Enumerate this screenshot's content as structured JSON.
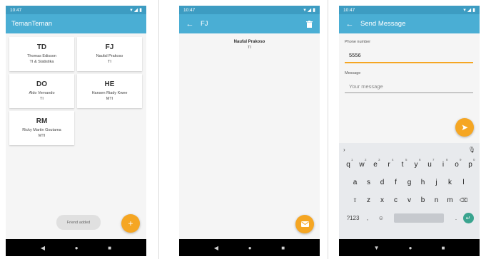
{
  "status": {
    "time": "10:47"
  },
  "screen1": {
    "title": "TemanTeman",
    "friends": [
      {
        "initials": "TD",
        "name": "Thomas Edisson",
        "dept": "TI & Statistika"
      },
      {
        "initials": "FJ",
        "name": "Naufal Prakoso",
        "dept": "TI"
      },
      {
        "initials": "DO",
        "name": "Aldo Vernando",
        "dept": "TI"
      },
      {
        "initials": "HE",
        "name": "Hansen Riady Kwee",
        "dept": "MTI"
      },
      {
        "initials": "RM",
        "name": "Ricky Martin Goutama",
        "dept": "MTI"
      }
    ],
    "toast": "Friend added",
    "fab_icon": "+"
  },
  "screen2": {
    "title": "FJ",
    "name": "Naufal Prakoso",
    "dept": "TI"
  },
  "screen3": {
    "title": "Send Message",
    "phone_label": "Phone number",
    "phone_value": "5556",
    "message_label": "Message",
    "message_placeholder": "Your message"
  },
  "keyboard": {
    "row1": [
      "q",
      "w",
      "e",
      "r",
      "t",
      "y",
      "u",
      "i",
      "o",
      "p"
    ],
    "row1_hints": [
      "1",
      "2",
      "3",
      "4",
      "5",
      "6",
      "7",
      "8",
      "9",
      "0"
    ],
    "row2": [
      "a",
      "s",
      "d",
      "f",
      "g",
      "h",
      "j",
      "k",
      "l"
    ],
    "row3": [
      "z",
      "x",
      "c",
      "v",
      "b",
      "n",
      "m"
    ],
    "symbols": "?123",
    "comma": ",",
    "period": "."
  },
  "colors": {
    "statusbar": "#3d9cc2",
    "appbar": "#4aaed4",
    "accent": "#f5a623"
  },
  "icons": [
    "back-arrow-icon",
    "delete-icon",
    "send-icon",
    "email-icon",
    "add-icon",
    "mic-icon",
    "shift-icon",
    "backspace-icon",
    "emoji-icon",
    "enter-icon",
    "nav-back-icon",
    "nav-home-icon",
    "nav-recents-icon"
  ]
}
